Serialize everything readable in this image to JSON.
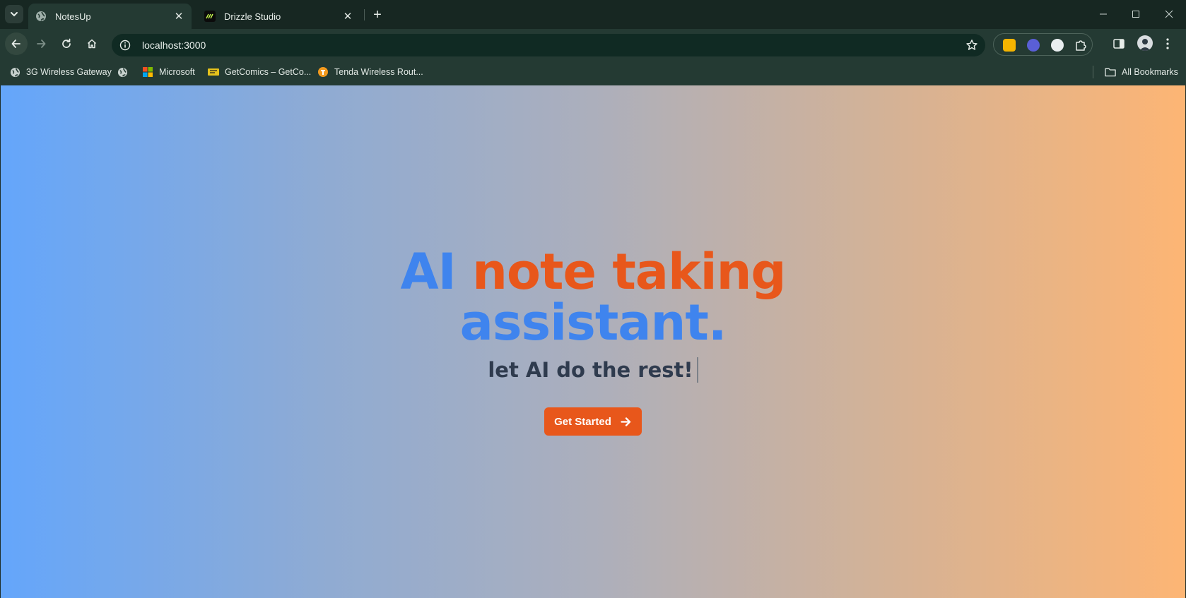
{
  "browser": {
    "tabs": [
      {
        "title": "NotesUp",
        "active": true,
        "icon": "globe-icon"
      },
      {
        "title": "Drizzle Studio",
        "active": false,
        "icon": "drizzle-icon"
      }
    ],
    "address": "localhost:3000",
    "bookmarks": [
      {
        "label": "3G Wireless Gateway",
        "icon": "globe-icon"
      },
      {
        "label": "",
        "icon": "globe-icon"
      },
      {
        "label": "Microsoft",
        "icon": "microsoft-icon"
      },
      {
        "label": "GetComics – GetCo...",
        "icon": "getcomics-icon"
      },
      {
        "label": "Tenda Wireless Rout...",
        "icon": "tenda-icon"
      }
    ],
    "all_bookmarks": "All Bookmarks"
  },
  "page": {
    "headline_word1": "AI",
    "headline_highlight": "note taking",
    "headline_line2": "assistant.",
    "subheadline": "let AI do the rest!",
    "cta_label": "Get Started"
  },
  "colors": {
    "blue": "#3f84ee",
    "orange": "#e8571b",
    "gradient_start": "#64a6fb",
    "gradient_end": "#fdb574"
  }
}
